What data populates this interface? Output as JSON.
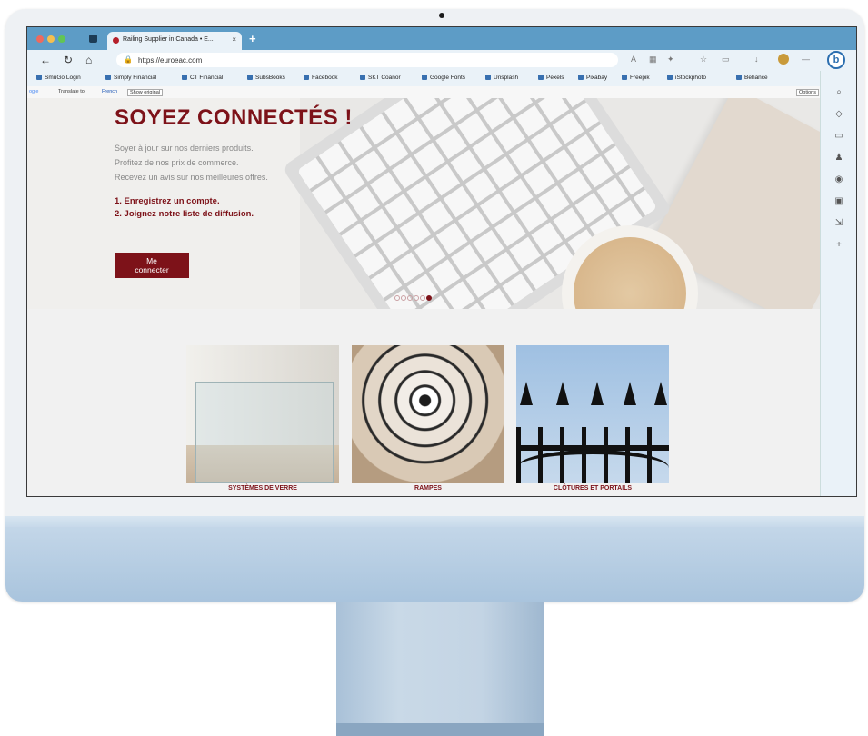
{
  "browser": {
    "tab_title": "Railing Supplier in Canada • E...",
    "tab_close": "×",
    "new_tab": "+",
    "url": "https://euroeac.com",
    "bing_label": "b"
  },
  "bookmarks": [
    "SmuGo Login",
    "Simply Financial",
    "CT Financial",
    "SubsBooks",
    "Facebook",
    "SKT Coanor",
    "Google Fonts",
    "Unsplash",
    "Pexels",
    "Pixabay",
    "Freepik",
    "iStockphoto",
    "Behance"
  ],
  "translate_bar": {
    "google": "ogle",
    "translate_to": "Translate to:",
    "language": "French",
    "show_original": "Show original",
    "options": "Options"
  },
  "hero": {
    "title": "SOYEZ CONNECTÉS !",
    "lines": [
      "Soyer à jour sur nos derniers produits.",
      "Profitez de nos prix de commerce.",
      "Recevez un avis sur nos meilleures offres."
    ],
    "steps": [
      "1. Enregistrez un compte.",
      "2. Joignez notre liste de diffusion."
    ],
    "button_line1": "Me",
    "button_line2": "connecter",
    "slide_count": 6,
    "active_slide": 6
  },
  "categories": [
    {
      "label": "SYSTÈMES DE VERRE"
    },
    {
      "label": "RAMPES"
    },
    {
      "label": "CLÔTURES ET PORTAILS"
    }
  ],
  "colors": {
    "brand": "#7d1219",
    "browser_chrome": "#5d9cc6",
    "imac_chin": "#b4cbe1"
  }
}
